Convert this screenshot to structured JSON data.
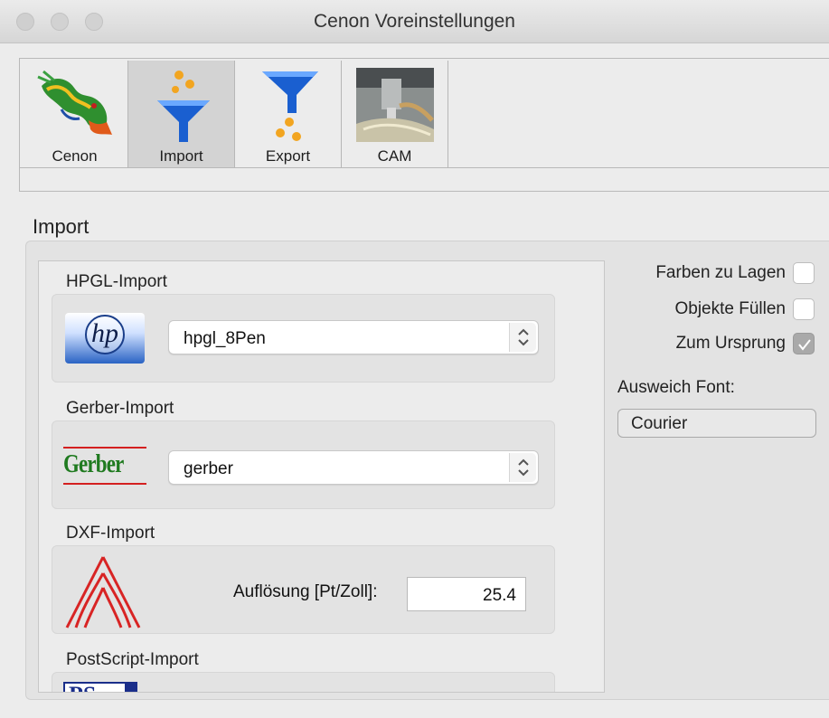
{
  "window": {
    "title": "Cenon Voreinstellungen"
  },
  "toolbar": {
    "items": [
      {
        "label": "Cenon",
        "icon": "dragon-icon",
        "selected": false
      },
      {
        "label": "Import",
        "icon": "funnel-import-icon",
        "selected": true
      },
      {
        "label": "Export",
        "icon": "funnel-export-icon",
        "selected": false
      },
      {
        "label": "CAM",
        "icon": "cam-machine-icon",
        "selected": false
      }
    ]
  },
  "section": {
    "title": "Import"
  },
  "hpgl": {
    "label": "HPGL-Import",
    "logo_text": "hp",
    "selected": "hpgl_8Pen"
  },
  "gerber": {
    "label": "Gerber-Import",
    "logo_text": "Gerber",
    "selected": "gerber"
  },
  "dxf": {
    "label": "DXF-Import",
    "resolution_label": "Auflösung [Pt/Zoll]:",
    "resolution_value": "25.4"
  },
  "postscript": {
    "label": "PostScript-Import",
    "logo_text": "PS"
  },
  "options": {
    "farben_label": "Farben zu Lagen",
    "farben_checked": false,
    "fuellen_label": "Objekte Füllen",
    "fuellen_checked": false,
    "ursprung_label": "Zum Ursprung",
    "ursprung_checked": true,
    "fallback_font_label": "Ausweich Font:",
    "fallback_font_value": "Courier"
  },
  "colors": {
    "selected_tab_bg": "#d3d3d3",
    "gerber_green": "#1f7a1f",
    "gerber_red": "#d42020",
    "hp_blue": "#2a63c4",
    "dxf_red": "#d82424"
  }
}
